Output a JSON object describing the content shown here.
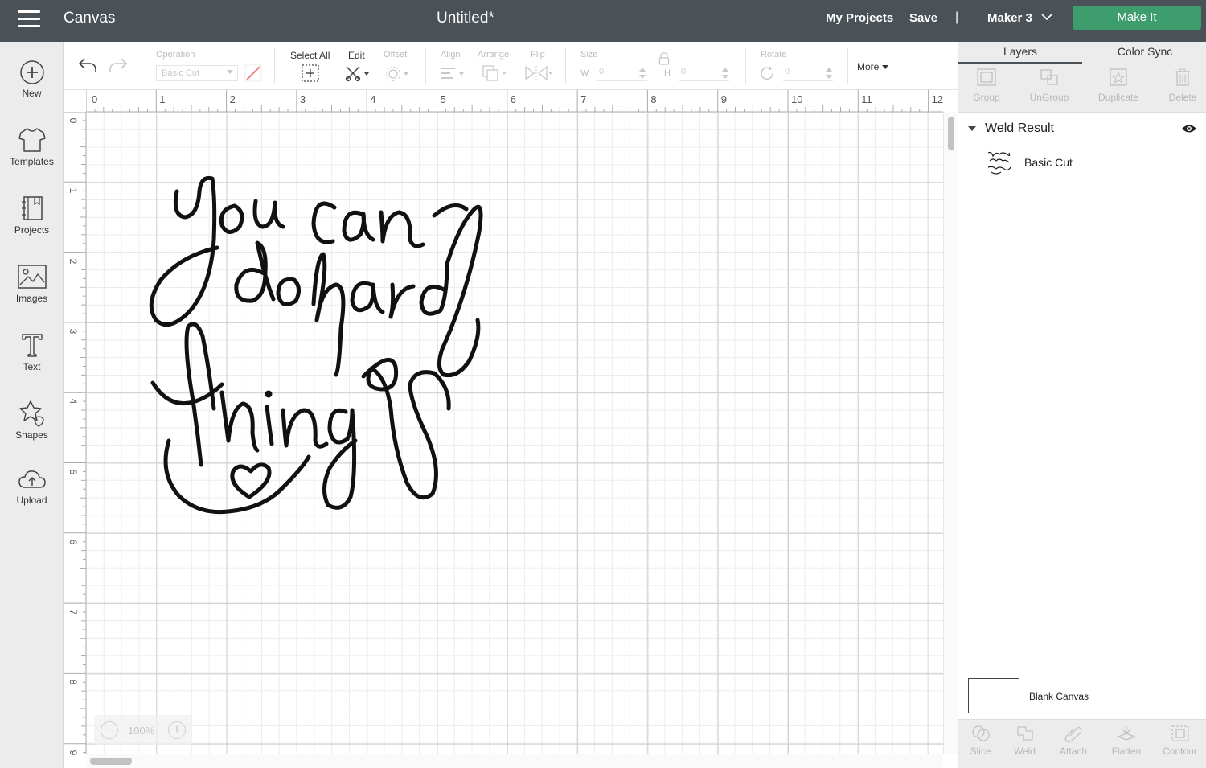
{
  "topbar": {
    "app_title": "Canvas",
    "doc_title": "Untitled*",
    "my_projects": "My Projects",
    "save": "Save",
    "separator": "|",
    "machine": "Maker 3",
    "make_it": "Make It",
    "make_it_color": "#3e9d6c",
    "bar_color": "#4a5157"
  },
  "sidebar": {
    "items": [
      {
        "label": "New",
        "icon": "plus-circle-icon"
      },
      {
        "label": "Templates",
        "icon": "tshirt-icon"
      },
      {
        "label": "Projects",
        "icon": "notebook-icon"
      },
      {
        "label": "Images",
        "icon": "image-icon"
      },
      {
        "label": "Text",
        "icon": "text-t-icon"
      },
      {
        "label": "Shapes",
        "icon": "shapes-icon"
      },
      {
        "label": "Upload",
        "icon": "cloud-upload-icon"
      }
    ]
  },
  "toolbar": {
    "operation_label": "Operation",
    "operation_value": "Basic Cut",
    "select_all": "Select All",
    "edit": "Edit",
    "offset": "Offset",
    "align": "Align",
    "arrange": "Arrange",
    "flip": "Flip",
    "size": "Size",
    "w_prefix": "W",
    "w_value": "0",
    "h_prefix": "H",
    "h_value": "0",
    "rotate": "Rotate",
    "rotate_value": "0",
    "more": "More"
  },
  "ruler": {
    "h": [
      "0",
      "1",
      "2",
      "3",
      "4",
      "5",
      "6",
      "7",
      "8",
      "9",
      "10",
      "11",
      "12"
    ],
    "v": [
      "0",
      "1",
      "2",
      "3",
      "4",
      "5",
      "6",
      "7",
      "8",
      "9"
    ]
  },
  "zoom": {
    "value": "100%"
  },
  "panel": {
    "tab_layers": "Layers",
    "tab_color_sync": "Color Sync",
    "actions": [
      "Group",
      "UnGroup",
      "Duplicate",
      "Delete"
    ],
    "group_name": "Weld Result",
    "layer_name": "Basic Cut",
    "blank_canvas": "Blank Canvas",
    "bottom_actions": [
      "Slice",
      "Weld",
      "Attach",
      "Flatten",
      "Contour"
    ]
  }
}
